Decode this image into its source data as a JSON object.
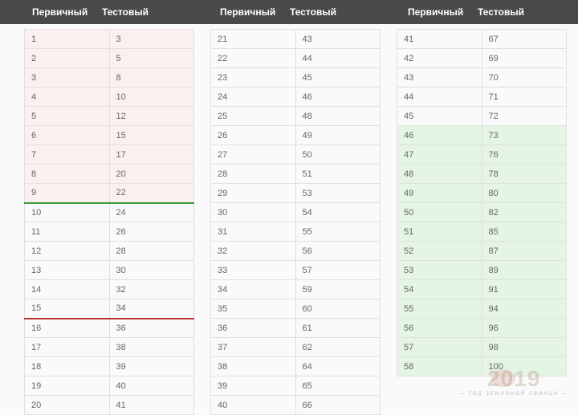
{
  "header": {
    "col1": "Первичный",
    "col2": "Тестовый"
  },
  "chart_data": {
    "type": "table",
    "columns": [
      "Первичный",
      "Тестовый"
    ],
    "sections": [
      {
        "rows": [
          {
            "p": 1,
            "t": 3,
            "c": "red"
          },
          {
            "p": 2,
            "t": 5,
            "c": "red"
          },
          {
            "p": 3,
            "t": 8,
            "c": "red"
          },
          {
            "p": 4,
            "t": 10,
            "c": "red"
          },
          {
            "p": 5,
            "t": 12,
            "c": "red"
          },
          {
            "p": 6,
            "t": 15,
            "c": "red"
          },
          {
            "p": 7,
            "t": 17,
            "c": "red"
          },
          {
            "p": 8,
            "t": 20,
            "c": "red"
          },
          {
            "p": 9,
            "t": 22,
            "c": "red"
          },
          {
            "p": 10,
            "t": 24,
            "sep": "g"
          },
          {
            "p": 11,
            "t": 26
          },
          {
            "p": 12,
            "t": 28
          },
          {
            "p": 13,
            "t": 30
          },
          {
            "p": 14,
            "t": 32
          },
          {
            "p": 15,
            "t": 34
          },
          {
            "p": 16,
            "t": 36,
            "sep": "r"
          },
          {
            "p": 17,
            "t": 38
          },
          {
            "p": 18,
            "t": 39
          },
          {
            "p": 19,
            "t": 40
          },
          {
            "p": 20,
            "t": 41
          }
        ]
      },
      {
        "rows": [
          {
            "p": 21,
            "t": 43
          },
          {
            "p": 22,
            "t": 44
          },
          {
            "p": 23,
            "t": 45
          },
          {
            "p": 24,
            "t": 46
          },
          {
            "p": 25,
            "t": 48
          },
          {
            "p": 26,
            "t": 49
          },
          {
            "p": 27,
            "t": 50
          },
          {
            "p": 28,
            "t": 51
          },
          {
            "p": 29,
            "t": 53
          },
          {
            "p": 30,
            "t": 54
          },
          {
            "p": 31,
            "t": 55
          },
          {
            "p": 32,
            "t": 56
          },
          {
            "p": 33,
            "t": 57
          },
          {
            "p": 34,
            "t": 59
          },
          {
            "p": 35,
            "t": 60
          },
          {
            "p": 36,
            "t": 61
          },
          {
            "p": 37,
            "t": 62
          },
          {
            "p": 38,
            "t": 64
          },
          {
            "p": 39,
            "t": 65
          },
          {
            "p": 40,
            "t": 66
          }
        ]
      },
      {
        "rows": [
          {
            "p": 41,
            "t": 67
          },
          {
            "p": 42,
            "t": 69
          },
          {
            "p": 43,
            "t": 70
          },
          {
            "p": 44,
            "t": 71
          },
          {
            "p": 45,
            "t": 72
          },
          {
            "p": 46,
            "t": 73,
            "c": "grn"
          },
          {
            "p": 47,
            "t": 76,
            "c": "grn"
          },
          {
            "p": 48,
            "t": 78,
            "c": "grn"
          },
          {
            "p": 49,
            "t": 80,
            "c": "grn"
          },
          {
            "p": 50,
            "t": 82,
            "c": "grn"
          },
          {
            "p": 51,
            "t": 85,
            "c": "grn"
          },
          {
            "p": 52,
            "t": 87,
            "c": "grn"
          },
          {
            "p": 53,
            "t": 89,
            "c": "grn"
          },
          {
            "p": 54,
            "t": 91,
            "c": "grn"
          },
          {
            "p": 55,
            "t": 94,
            "c": "grn"
          },
          {
            "p": 56,
            "t": 96,
            "c": "grn"
          },
          {
            "p": 57,
            "t": 98,
            "c": "grn"
          },
          {
            "p": 58,
            "t": 100,
            "c": "grn"
          }
        ]
      }
    ]
  },
  "watermark": {
    "year": "2019",
    "sub": "— ГОД ЗЕМЛЯНОЙ СВИНЬИ —"
  }
}
